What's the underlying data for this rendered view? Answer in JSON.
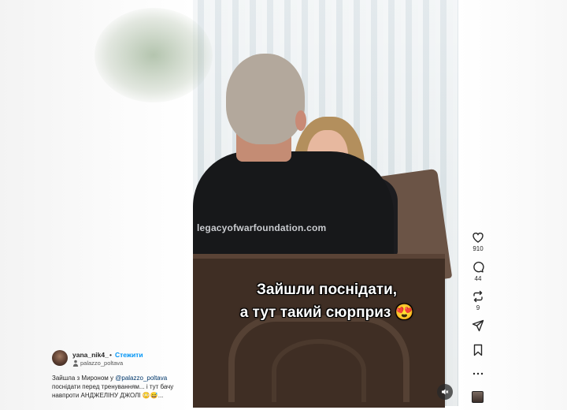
{
  "post": {
    "username": "yana_nik4_",
    "separator": "•",
    "follow_label": "Стежити",
    "location": "palazzo_poltava",
    "description_before": "Зайшла з Мироном у ",
    "description_mention": "@palazzo_poltava",
    "description_after": " поснідати перед тренуванням... і тут бачу навпроти АНДЖЕЛІНУ ДЖОЛІ 😳😅..."
  },
  "video": {
    "caption_line1": "Зайшли поснідати,",
    "caption_line2": "а тут такий сюрприз 😍",
    "shirt_text": "legacyofwarfoundation.com",
    "mute_icon": "speaker-muted-icon"
  },
  "actions": {
    "like_count": "910",
    "comment_count": "44",
    "repost_count": "9",
    "icons": [
      "heart-icon",
      "comment-icon",
      "repost-icon",
      "share-icon",
      "bookmark-icon",
      "more-icon"
    ]
  },
  "colors": {
    "accent": "#0095f6",
    "mention": "#00376b",
    "text": "#262626"
  }
}
